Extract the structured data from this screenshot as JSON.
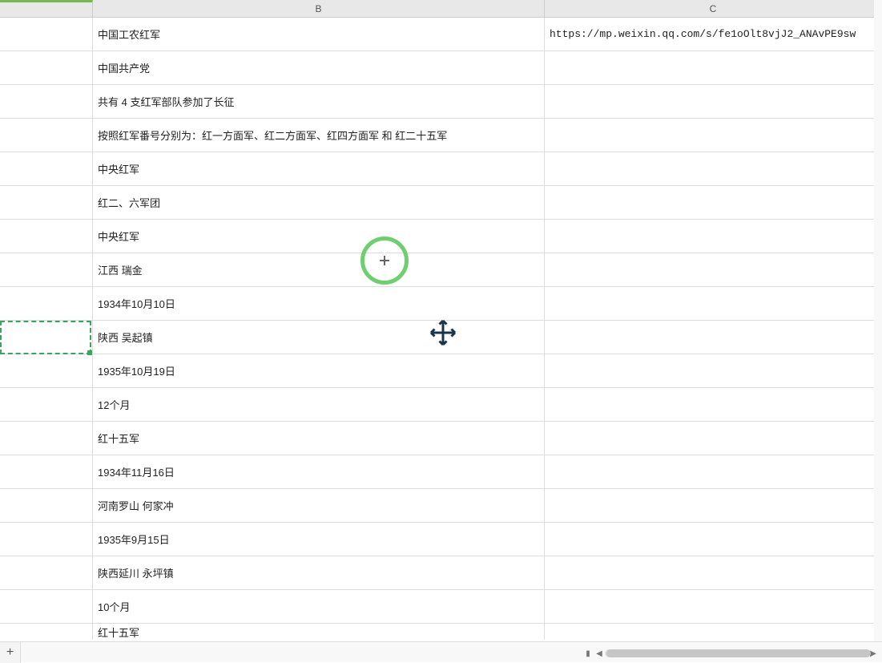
{
  "columns": {
    "B": "B",
    "C": "C"
  },
  "rows": [
    {
      "b": "中国工农红军",
      "c": "https://mp.weixin.qq.com/s/fe1oOlt8vjJ2_ANAvPE9sw"
    },
    {
      "b": "中国共产党",
      "c": ""
    },
    {
      "b": "共有 4 支红军部队参加了长征",
      "c": ""
    },
    {
      "b": "按照红军番号分别为：红一方面军、红二方面军、红四方面军 和 红二十五军",
      "c": ""
    },
    {
      "b": "中央红军",
      "c": ""
    },
    {
      "b": "红二、六军团",
      "c": ""
    },
    {
      "b": "中央红军",
      "c": ""
    },
    {
      "b": "江西 瑞金",
      "c": ""
    },
    {
      "b": "1934年10月10日",
      "c": ""
    },
    {
      "b": "陕西 吴起镇",
      "c": ""
    },
    {
      "b": "1935年10月19日",
      "c": ""
    },
    {
      "b": "12个月",
      "c": ""
    },
    {
      "b": "红十五军",
      "c": ""
    },
    {
      "b": "1934年11月16日",
      "c": ""
    },
    {
      "b": "河南罗山 何家冲",
      "c": ""
    },
    {
      "b": "1935年9月15日",
      "c": ""
    },
    {
      "b": "陕西延川 永坪镇",
      "c": ""
    },
    {
      "b": "10个月",
      "c": ""
    },
    {
      "b": "红十五军",
      "c": ""
    }
  ],
  "icons": {
    "add_sheet": "+"
  },
  "chart_data": null
}
